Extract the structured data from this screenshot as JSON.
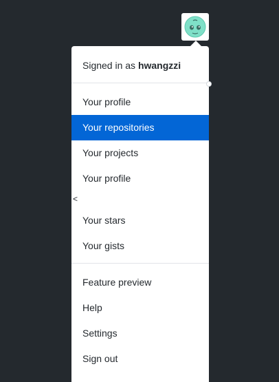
{
  "account": {
    "signed_in_prefix": "Signed in as",
    "username": "hwangzzi"
  },
  "menu": {
    "group1": [
      {
        "label": "Your profile",
        "active": false
      },
      {
        "label": "Your repositories",
        "active": true
      },
      {
        "label": "Your projects",
        "active": false
      },
      {
        "label": "Your profile",
        "active": false
      }
    ],
    "stray_glyph": "<",
    "group2": [
      {
        "label": "Your stars"
      },
      {
        "label": "Your gists"
      }
    ],
    "group3": [
      {
        "label": "Feature preview"
      },
      {
        "label": "Help"
      },
      {
        "label": "Settings"
      },
      {
        "label": "Sign out"
      }
    ]
  },
  "colors": {
    "page_bg": "#24292e",
    "menu_bg": "#ffffff",
    "active_bg": "#0366d6",
    "text": "#24292e",
    "avatar_face": "#7fe0c8"
  },
  "icons": {
    "avatar": "avatar-icon"
  }
}
